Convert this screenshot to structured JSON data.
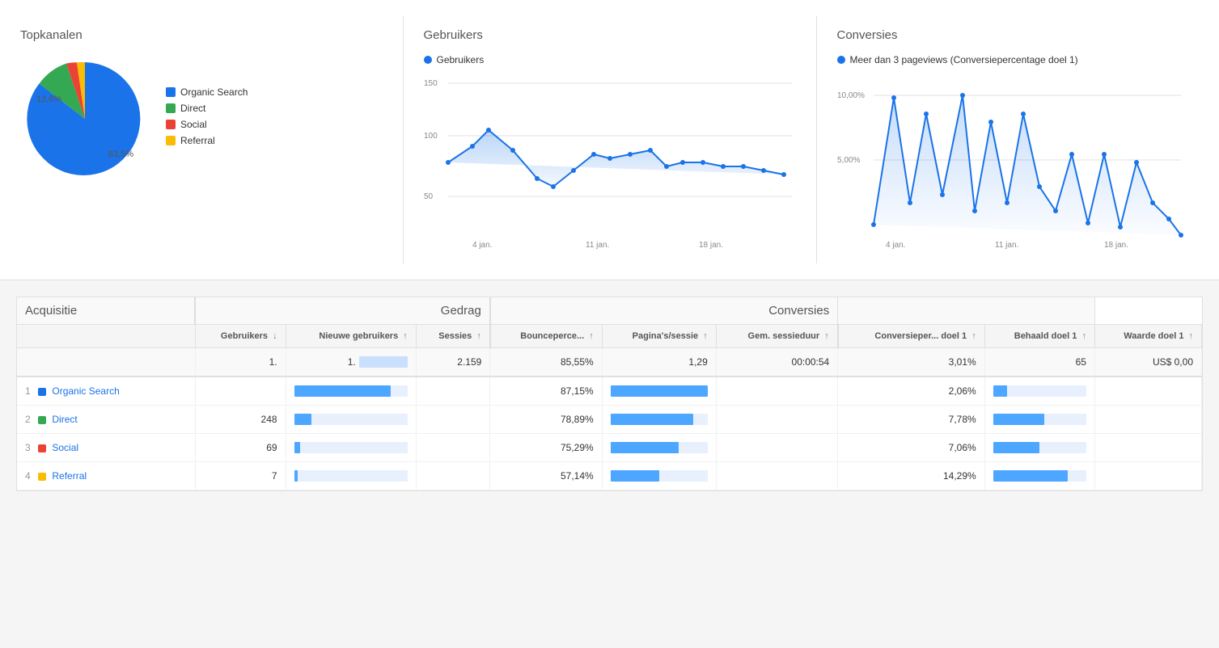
{
  "topkanalen": {
    "title": "Topkanalen",
    "pie": {
      "organic_pct": "83,5%",
      "direct_pct": "12,6%"
    },
    "legend": [
      {
        "label": "Organic Search",
        "color": "#1a73e8"
      },
      {
        "label": "Direct",
        "color": "#34a853"
      },
      {
        "label": "Social",
        "color": "#ea4335"
      },
      {
        "label": "Referral",
        "color": "#fbbc04"
      }
    ]
  },
  "gebruikers": {
    "title": "Gebruikers",
    "legend_label": "Gebruikers",
    "y_labels": [
      "150",
      "100",
      "50"
    ],
    "x_labels": [
      "4 jan.",
      "11 jan.",
      "18 jan."
    ]
  },
  "conversies_top": {
    "title": "Conversies",
    "legend_label": "Meer dan 3 pageviews (Conversiepercentage doel 1)",
    "y_labels": [
      "10,00%",
      "5,00%"
    ],
    "x_labels": [
      "4 jan.",
      "11 jan.",
      "18 jan."
    ]
  },
  "table": {
    "acquisitie_header": "Acquisitie",
    "gedrag_header": "Gedrag",
    "conversies_header": "Conversies",
    "columns": {
      "gebruikers": "Gebruikers",
      "nieuwe_gebruikers": "Nieuwe gebruikers",
      "sessies": "Sessies",
      "bounceperce": "Bounceperce...",
      "paginas_sessie": "Pagina's/sessie",
      "gem_sessieduur": "Gem. sessieduur",
      "conversieper_doel1": "Conversieper... doel 1",
      "behaald_doel1": "Behaald doel 1",
      "waarde_doel1": "Waarde doel 1"
    },
    "total_row": {
      "gebruikers": "1.",
      "nieuwe_gebruikers": "1.",
      "sessies": "2.159",
      "bounceperce": "85,55%",
      "paginas_sessie": "1,29",
      "gem_sessieduur": "00:00:54",
      "conversieper": "3,01%",
      "behaald_doel1": "65",
      "waarde_doel1": "US$ 0,00"
    },
    "rows": [
      {
        "rank": "1",
        "color": "#1a73e8",
        "channel": "Organic Search",
        "gebruikers": "",
        "nieuwe_bar": 85,
        "sessies": "",
        "bounceperce": "87,15%",
        "paginas_bar": 100,
        "gem_sessieduur": "",
        "conversieper": "2,06%",
        "behaald_bar": 15,
        "waarde": ""
      },
      {
        "rank": "2",
        "color": "#34a853",
        "channel": "Direct",
        "gebruikers": "248",
        "nieuwe_bar": 15,
        "sessies": "",
        "bounceperce": "78,89%",
        "paginas_bar": 85,
        "gem_sessieduur": "",
        "conversieper": "7,78%",
        "behaald_bar": 55,
        "waarde": ""
      },
      {
        "rank": "3",
        "color": "#ea4335",
        "channel": "Social",
        "gebruikers": "69",
        "nieuwe_bar": 5,
        "sessies": "",
        "bounceperce": "75,29%",
        "paginas_bar": 70,
        "gem_sessieduur": "",
        "conversieper": "7,06%",
        "behaald_bar": 50,
        "waarde": ""
      },
      {
        "rank": "4",
        "color": "#fbbc04",
        "channel": "Referral",
        "gebruikers": "7",
        "nieuwe_bar": 3,
        "sessies": "",
        "bounceperce": "57,14%",
        "paginas_bar": 50,
        "gem_sessieduur": "",
        "conversieper": "14,29%",
        "behaald_bar": 80,
        "waarde": ""
      }
    ]
  }
}
